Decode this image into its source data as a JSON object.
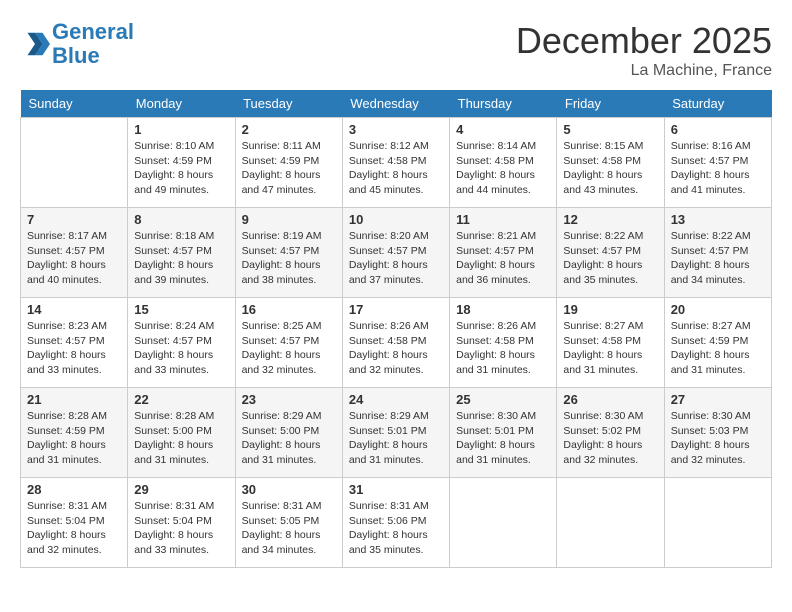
{
  "header": {
    "logo_line1": "General",
    "logo_line2": "Blue",
    "month": "December 2025",
    "location": "La Machine, France"
  },
  "days_of_week": [
    "Sunday",
    "Monday",
    "Tuesday",
    "Wednesday",
    "Thursday",
    "Friday",
    "Saturday"
  ],
  "weeks": [
    [
      {
        "num": "",
        "info": ""
      },
      {
        "num": "1",
        "info": "Sunrise: 8:10 AM\nSunset: 4:59 PM\nDaylight: 8 hours\nand 49 minutes."
      },
      {
        "num": "2",
        "info": "Sunrise: 8:11 AM\nSunset: 4:59 PM\nDaylight: 8 hours\nand 47 minutes."
      },
      {
        "num": "3",
        "info": "Sunrise: 8:12 AM\nSunset: 4:58 PM\nDaylight: 8 hours\nand 45 minutes."
      },
      {
        "num": "4",
        "info": "Sunrise: 8:14 AM\nSunset: 4:58 PM\nDaylight: 8 hours\nand 44 minutes."
      },
      {
        "num": "5",
        "info": "Sunrise: 8:15 AM\nSunset: 4:58 PM\nDaylight: 8 hours\nand 43 minutes."
      },
      {
        "num": "6",
        "info": "Sunrise: 8:16 AM\nSunset: 4:57 PM\nDaylight: 8 hours\nand 41 minutes."
      }
    ],
    [
      {
        "num": "7",
        "info": "Sunrise: 8:17 AM\nSunset: 4:57 PM\nDaylight: 8 hours\nand 40 minutes."
      },
      {
        "num": "8",
        "info": "Sunrise: 8:18 AM\nSunset: 4:57 PM\nDaylight: 8 hours\nand 39 minutes."
      },
      {
        "num": "9",
        "info": "Sunrise: 8:19 AM\nSunset: 4:57 PM\nDaylight: 8 hours\nand 38 minutes."
      },
      {
        "num": "10",
        "info": "Sunrise: 8:20 AM\nSunset: 4:57 PM\nDaylight: 8 hours\nand 37 minutes."
      },
      {
        "num": "11",
        "info": "Sunrise: 8:21 AM\nSunset: 4:57 PM\nDaylight: 8 hours\nand 36 minutes."
      },
      {
        "num": "12",
        "info": "Sunrise: 8:22 AM\nSunset: 4:57 PM\nDaylight: 8 hours\nand 35 minutes."
      },
      {
        "num": "13",
        "info": "Sunrise: 8:22 AM\nSunset: 4:57 PM\nDaylight: 8 hours\nand 34 minutes."
      }
    ],
    [
      {
        "num": "14",
        "info": "Sunrise: 8:23 AM\nSunset: 4:57 PM\nDaylight: 8 hours\nand 33 minutes."
      },
      {
        "num": "15",
        "info": "Sunrise: 8:24 AM\nSunset: 4:57 PM\nDaylight: 8 hours\nand 33 minutes."
      },
      {
        "num": "16",
        "info": "Sunrise: 8:25 AM\nSunset: 4:57 PM\nDaylight: 8 hours\nand 32 minutes."
      },
      {
        "num": "17",
        "info": "Sunrise: 8:26 AM\nSunset: 4:58 PM\nDaylight: 8 hours\nand 32 minutes."
      },
      {
        "num": "18",
        "info": "Sunrise: 8:26 AM\nSunset: 4:58 PM\nDaylight: 8 hours\nand 31 minutes."
      },
      {
        "num": "19",
        "info": "Sunrise: 8:27 AM\nSunset: 4:58 PM\nDaylight: 8 hours\nand 31 minutes."
      },
      {
        "num": "20",
        "info": "Sunrise: 8:27 AM\nSunset: 4:59 PM\nDaylight: 8 hours\nand 31 minutes."
      }
    ],
    [
      {
        "num": "21",
        "info": "Sunrise: 8:28 AM\nSunset: 4:59 PM\nDaylight: 8 hours\nand 31 minutes."
      },
      {
        "num": "22",
        "info": "Sunrise: 8:28 AM\nSunset: 5:00 PM\nDaylight: 8 hours\nand 31 minutes."
      },
      {
        "num": "23",
        "info": "Sunrise: 8:29 AM\nSunset: 5:00 PM\nDaylight: 8 hours\nand 31 minutes."
      },
      {
        "num": "24",
        "info": "Sunrise: 8:29 AM\nSunset: 5:01 PM\nDaylight: 8 hours\nand 31 minutes."
      },
      {
        "num": "25",
        "info": "Sunrise: 8:30 AM\nSunset: 5:01 PM\nDaylight: 8 hours\nand 31 minutes."
      },
      {
        "num": "26",
        "info": "Sunrise: 8:30 AM\nSunset: 5:02 PM\nDaylight: 8 hours\nand 32 minutes."
      },
      {
        "num": "27",
        "info": "Sunrise: 8:30 AM\nSunset: 5:03 PM\nDaylight: 8 hours\nand 32 minutes."
      }
    ],
    [
      {
        "num": "28",
        "info": "Sunrise: 8:31 AM\nSunset: 5:04 PM\nDaylight: 8 hours\nand 32 minutes."
      },
      {
        "num": "29",
        "info": "Sunrise: 8:31 AM\nSunset: 5:04 PM\nDaylight: 8 hours\nand 33 minutes."
      },
      {
        "num": "30",
        "info": "Sunrise: 8:31 AM\nSunset: 5:05 PM\nDaylight: 8 hours\nand 34 minutes."
      },
      {
        "num": "31",
        "info": "Sunrise: 8:31 AM\nSunset: 5:06 PM\nDaylight: 8 hours\nand 35 minutes."
      },
      {
        "num": "",
        "info": ""
      },
      {
        "num": "",
        "info": ""
      },
      {
        "num": "",
        "info": ""
      }
    ]
  ]
}
